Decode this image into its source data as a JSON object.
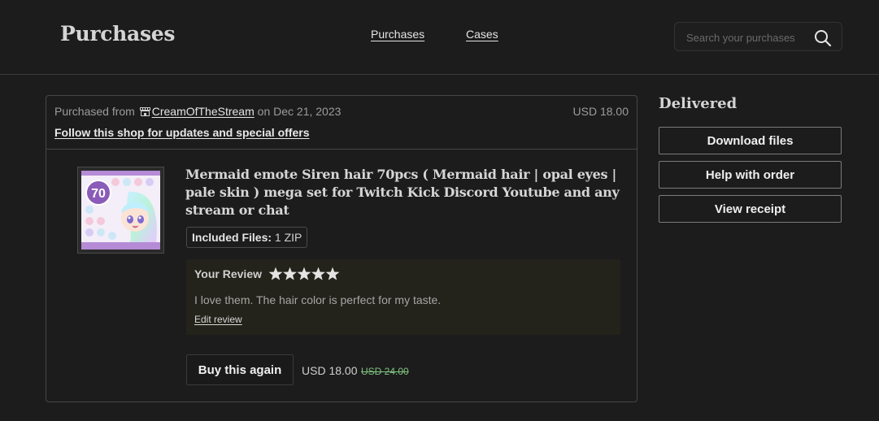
{
  "header": {
    "title": "Purchases",
    "nav": [
      {
        "label": "Purchases"
      },
      {
        "label": "Cases"
      }
    ],
    "search": {
      "placeholder": "Search your purchases",
      "value": "",
      "icon": "search-icon"
    }
  },
  "order": {
    "purchased_from_prefix": "Purchased from",
    "shop_icon": "shop-icon",
    "shop_name": "CreamOfTheStream",
    "date_text": "on Dec 21, 2023",
    "total": "USD 18.00",
    "follow_text": "Follow this shop for updates and special offers",
    "item": {
      "thumbnail_badge": "70",
      "title": "Mermaid emote Siren hair 70pcs ( Mermaid hair | opal eyes | pale skin ) mega set for Twitch Kick Discord Youtube and any stream or chat",
      "files_label": "Included Files:",
      "files_value": "1 ZIP",
      "review": {
        "label": "Your Review",
        "rating": 5,
        "max_rating": 5,
        "text": "I love them. The hair color is perfect for my taste.",
        "edit_label": "Edit review"
      },
      "buy_again_label": "Buy this again",
      "price": "USD 18.00",
      "original_price": "USD 24.00"
    }
  },
  "sidebar": {
    "status": "Delivered",
    "buttons": [
      {
        "label": "Download files"
      },
      {
        "label": "Help with order"
      },
      {
        "label": "View receipt"
      }
    ]
  },
  "colors": {
    "background": "#1c1c1c",
    "strike_price": "#7fc27f",
    "review_bg": "#23231b",
    "star": "#e4e4e4"
  }
}
